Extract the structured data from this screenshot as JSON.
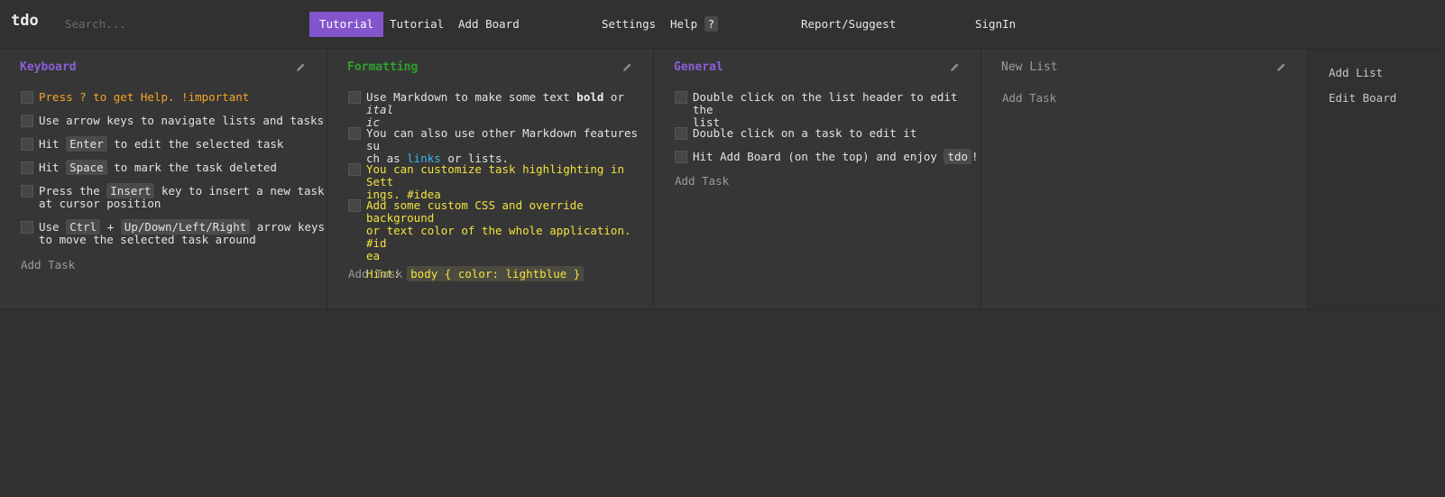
{
  "app": {
    "logo": "tdo",
    "search_placeholder": "Search...",
    "nav": [
      {
        "label": "Tutorial",
        "active": true
      },
      {
        "label": "Tutorial"
      },
      {
        "label": "Add Board"
      },
      {
        "label": "Settings"
      },
      {
        "label": "Help"
      },
      {
        "label": "Report/Suggest"
      },
      {
        "label": "SignIn"
      }
    ],
    "help_badge": "?"
  },
  "lists": [
    {
      "title": "Keyboard",
      "title_color": "#8b5fd8",
      "add_task": "Add Task",
      "tasks": [
        {
          "parts": [
            "Press ? to get Help. !important"
          ]
        },
        {
          "parts": [
            "Use arrow keys to navigate lists and tasks"
          ]
        },
        {
          "parts": [
            "Hit ",
            "Enter",
            " to edit the selected task"
          ]
        },
        {
          "parts": [
            "Hit ",
            "Space",
            " to mark the task deleted"
          ]
        },
        {
          "parts": [
            "Press the ",
            "Insert",
            " key to insert a new task",
            "at cursor position"
          ]
        },
        {
          "parts": [
            "Use ",
            "Ctrl",
            " + ",
            "Up/Down/Left/Right",
            " arrow keys",
            "to move the selected task around"
          ]
        }
      ]
    },
    {
      "title": "Formatting",
      "title_color": "#2ea02e",
      "add_task": "Add Task",
      "tasks": [
        {
          "parts": [
            "Use Markdown to make some text ",
            "bold",
            " or ",
            "ital",
            "ic"
          ]
        },
        {
          "parts": [
            "You can also use other Markdown features su",
            "ch as ",
            "links",
            " or lists."
          ]
        },
        {
          "parts": [
            "You can customize task highlighting in Sett",
            "ings. #idea"
          ]
        },
        {
          "parts": [
            "Add some custom CSS and override background",
            "or text color of the whole application. #id",
            "ea",
            "Hint: ",
            "body { color: lightblue }"
          ]
        }
      ]
    },
    {
      "title": "General",
      "title_color": "#8b5fd8",
      "add_task": "Add Task",
      "tasks": [
        {
          "parts": [
            "Double click on the list header to edit the",
            "list"
          ]
        },
        {
          "parts": [
            "Double click on a task to edit it"
          ]
        },
        {
          "parts": [
            "Hit Add Board (on the top) and enjoy ",
            "tdo",
            "!"
          ]
        }
      ]
    },
    {
      "title": "New List",
      "title_color": "#9a9a9a",
      "add_task": "Add Task",
      "tasks": []
    }
  ],
  "side": {
    "add_list": "Add List",
    "edit_board": "Edit Board"
  }
}
